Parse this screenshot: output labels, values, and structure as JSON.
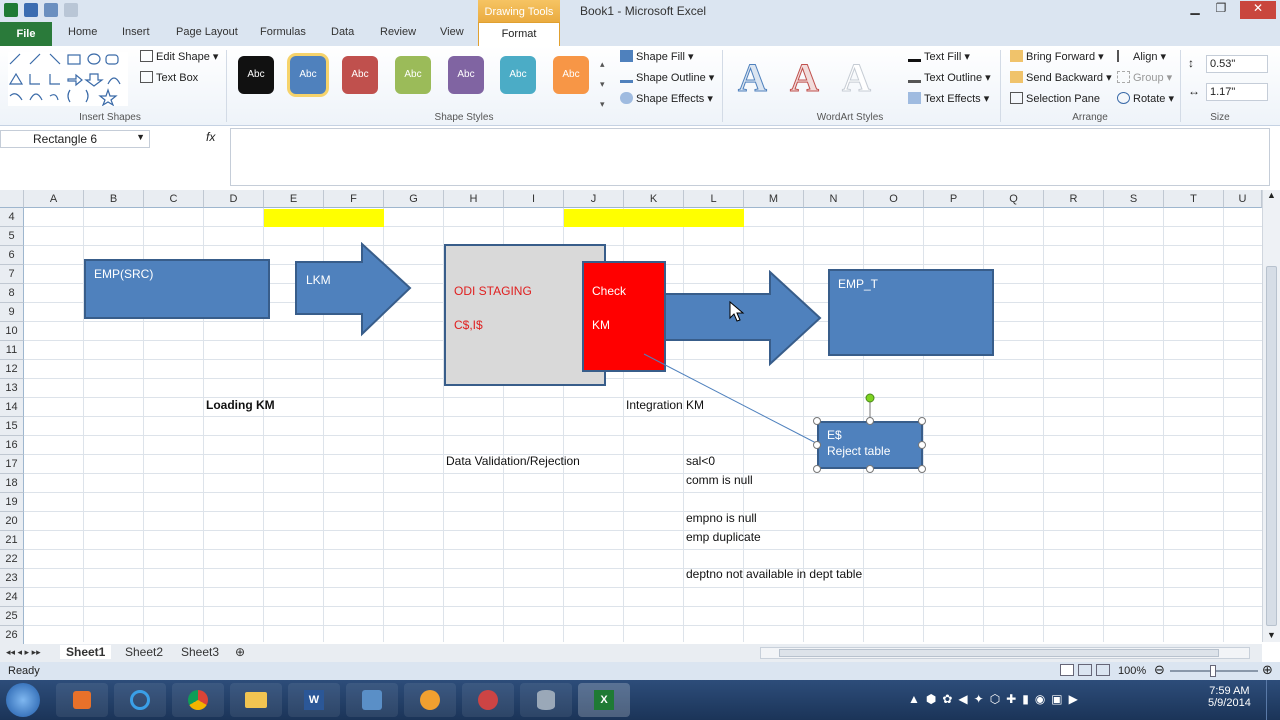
{
  "titlebar": {
    "title": "Book1  -  Microsoft Excel",
    "contextual": "Drawing Tools"
  },
  "tabs": [
    "File",
    "Home",
    "Insert",
    "Page Layout",
    "Formulas",
    "Data",
    "Review",
    "View",
    "Format"
  ],
  "ribbon": {
    "insert_shapes": {
      "label": "Insert Shapes",
      "edit_shape": "Edit Shape",
      "text_box": "Text Box"
    },
    "shape_styles": {
      "label": "Shape Styles",
      "swatch_text": "Abc",
      "fill": "Shape Fill",
      "outline": "Shape Outline",
      "effects": "Shape Effects"
    },
    "wordart": {
      "label": "WordArt Styles",
      "text_fill": "Text Fill",
      "text_outline": "Text Outline",
      "text_effects": "Text Effects"
    },
    "arrange": {
      "label": "Arrange",
      "bring_forward": "Bring Forward",
      "send_backward": "Send Backward",
      "selection_pane": "Selection Pane",
      "align": "Align",
      "group": "Group",
      "rotate": "Rotate"
    },
    "size": {
      "label": "Size",
      "height": "0.53\"",
      "width": "1.17\""
    }
  },
  "formula_bar": {
    "name_box": "Rectangle 6",
    "fx": "fx",
    "value": ""
  },
  "columns": [
    "A",
    "B",
    "C",
    "D",
    "E",
    "F",
    "G",
    "H",
    "I",
    "J",
    "K",
    "L",
    "M",
    "N",
    "O",
    "P",
    "Q",
    "R",
    "S",
    "T",
    "U"
  ],
  "rows": [
    "4",
    "5",
    "6",
    "7",
    "8",
    "9",
    "10",
    "11",
    "12",
    "13",
    "14",
    "15",
    "16",
    "17",
    "18",
    "19",
    "20",
    "21",
    "22",
    "23",
    "24",
    "25",
    "26"
  ],
  "shapes": {
    "emp_src": "EMP(SRC)",
    "lkm": "LKM",
    "odi_staging": "ODI STAGING",
    "staging_tables": "C$,I$",
    "check": "Check",
    "km": "KM",
    "emp_t": "EMP_T",
    "reject_line1": "E$",
    "reject_line2": "Reject table"
  },
  "cells": {
    "loading_km": "Loading KM",
    "integration_km": "Integration KM",
    "data_validation": "Data Validation/Rejection",
    "rule1": "sal<0",
    "rule2": "comm is null",
    "rule3": "empno is null",
    "rule4": "emp duplicate",
    "rule5": "deptno not available in dept table"
  },
  "sheets": [
    "Sheet1",
    "Sheet2",
    "Sheet3"
  ],
  "status": {
    "ready": "Ready",
    "zoom": "100%"
  },
  "clock": {
    "time": "7:59 AM",
    "date": "5/9/2014"
  },
  "colors": {
    "shape_fill": "#4f81bd",
    "shape_border": "#385d8a",
    "check_fill": "#ff0000",
    "highlight": "#ffff00",
    "staging_fill": "#d9d9d9"
  }
}
